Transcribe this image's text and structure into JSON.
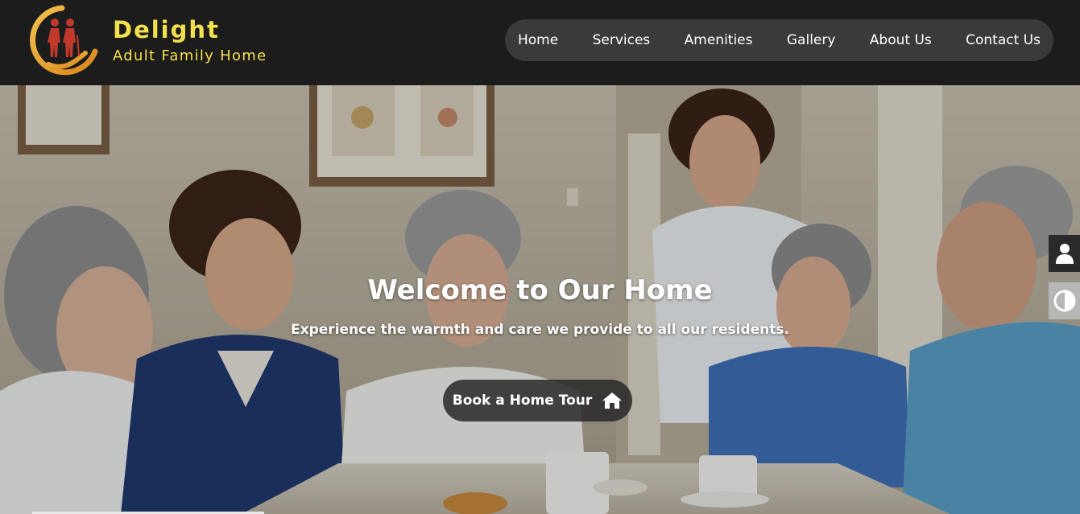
{
  "brand": {
    "title": "Delight",
    "subtitle": "Adult Family Home",
    "logo_icon": "caregiver-hands-logo"
  },
  "nav": {
    "items": [
      "Home",
      "Services",
      "Amenities",
      "Gallery",
      "About Us",
      "Contact Us"
    ]
  },
  "hero": {
    "title": "Welcome to Our Home",
    "subtitle": "Experience the warmth and care we provide to all our residents.",
    "cta_label": "Book a Home Tour",
    "cta_icon": "home-icon"
  },
  "side_tools": {
    "user_icon": "user-icon",
    "contrast_icon": "contrast-icon"
  },
  "colors": {
    "header_bg": "#1c1c1c",
    "nav_bg": "#3a3a3a",
    "brand_yellow": "#f4e04d",
    "logo_gold": "#e8a12a"
  }
}
